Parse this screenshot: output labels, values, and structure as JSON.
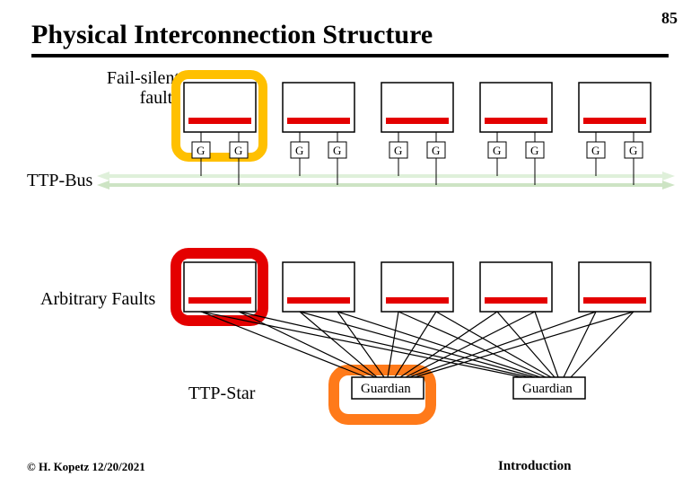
{
  "page_number": "85",
  "title": "Physical Interconnection Structure",
  "labels": {
    "fail_silent": "Fail-silent\nfaults",
    "ttp_bus": "TTP-Bus",
    "arbitrary": "Arbitrary Faults",
    "ttp_star": "TTP-Star"
  },
  "node_g_label": "G",
  "guardian_label": "Guardian",
  "footer": {
    "left": "© H. Kopetz 12/20/2021",
    "right": "Introduction"
  },
  "colors": {
    "highlight_stroke": "#ffc000",
    "red_bar": "#e40000",
    "red_box": "#e40000",
    "orange_box": "#ff7a1a",
    "bus_light": "#dff0da",
    "bus_dark": "#cde4c4"
  },
  "diagram": {
    "top_nodes": 5,
    "bottom_nodes": 5,
    "g_per_node": 2,
    "guardians": 2
  }
}
